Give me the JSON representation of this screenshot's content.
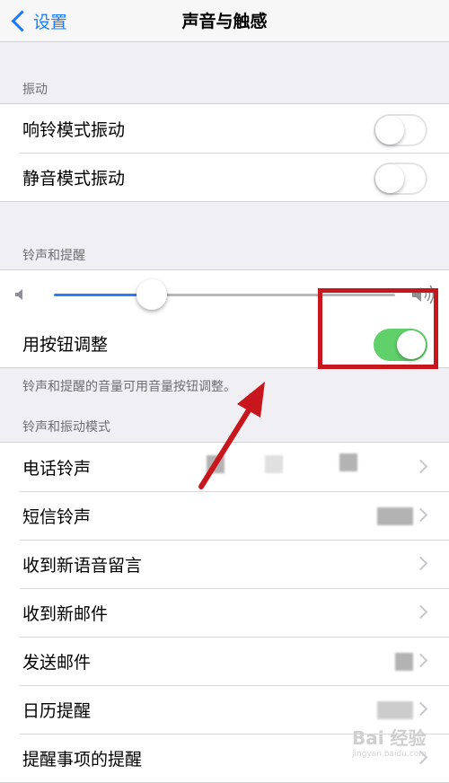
{
  "nav": {
    "back_label": "设置",
    "title": "声音与触感"
  },
  "vibration": {
    "header": "振动",
    "rows": [
      {
        "label": "响铃模式振动",
        "toggle": "off"
      },
      {
        "label": "静音模式振动",
        "toggle": "off"
      }
    ]
  },
  "ringer": {
    "header": "铃声和提醒",
    "volume_level": 0.29,
    "button_adjust_label": "用按钮调整",
    "button_adjust_toggle": "on",
    "footer": "铃声和提醒的音量可用音量按钮调整。"
  },
  "patterns": {
    "header": "铃声和振动模式",
    "rows": [
      {
        "label": "电话铃声"
      },
      {
        "label": "短信铃声"
      },
      {
        "label": "收到新语音留言"
      },
      {
        "label": "收到新邮件"
      },
      {
        "label": "发送邮件"
      },
      {
        "label": "日历提醒"
      },
      {
        "label": "提醒事项的提醒"
      }
    ]
  },
  "colors": {
    "accent": "#1a7cf7",
    "toggle_on": "#5fd06a",
    "annotation": "#c8171c"
  },
  "watermark": {
    "main": "Bai 经验",
    "sub": "jingyan.baidu.com"
  }
}
